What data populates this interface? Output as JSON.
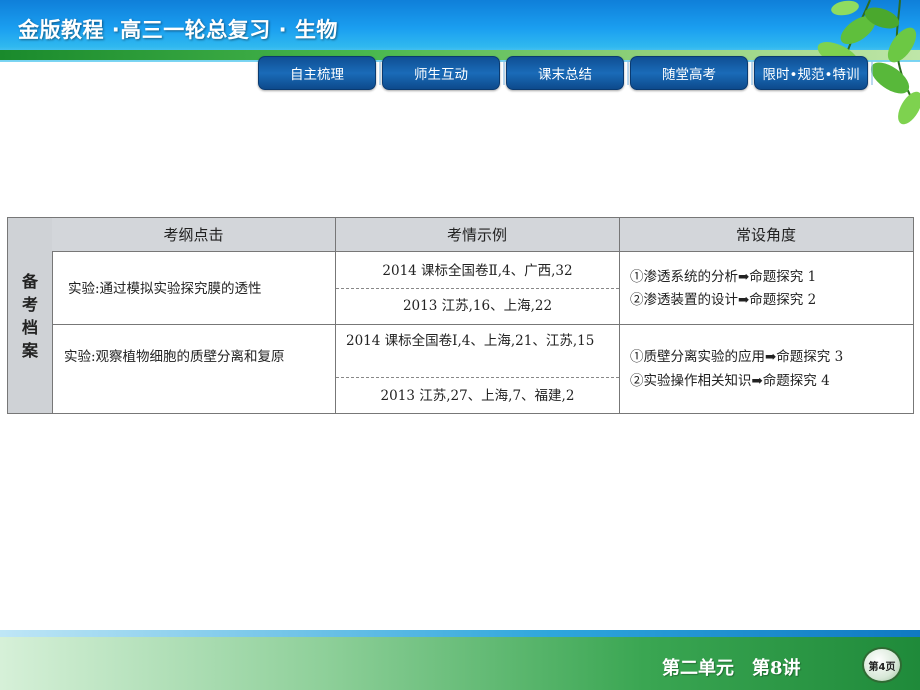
{
  "header": {
    "title": "金版教程 ·高三一轮总复习 · 生物"
  },
  "nav": {
    "tabs": [
      "自主梳理",
      "师生互动",
      "课末总结",
      "随堂高考",
      "限时•规范•特训"
    ]
  },
  "table": {
    "side_label": "备考档案",
    "columns": [
      "考纲点击",
      "考情示例",
      "常设角度"
    ],
    "rows": [
      {
        "point": "实验:通过模拟实验探究膜的透性",
        "examples": [
          "2014 课标全国卷Ⅱ,4、广西,32",
          "2013 江苏,16、上海,22"
        ],
        "angles": [
          "①渗透系统的分析➡命题探究 1",
          "②渗透装置的设计➡命题探究 2"
        ]
      },
      {
        "point": "实验:观察植物细胞的质壁分离和复原",
        "examples": [
          "2014 课标全国卷Ⅰ,4、上海,21、江苏,15",
          "2013 江苏,27、上海,7、福建,2"
        ],
        "angles": [
          "①质壁分离实验的应用➡命题探究 3",
          "②实验操作相关知识➡命题探究 4"
        ]
      }
    ]
  },
  "footer": {
    "unit": "第二单元　第8讲",
    "page": "第4页"
  },
  "colors": {
    "header_blue": "#1a9ef0",
    "tab_blue": "#1a6bb8",
    "footer_green": "#2f9a43"
  }
}
